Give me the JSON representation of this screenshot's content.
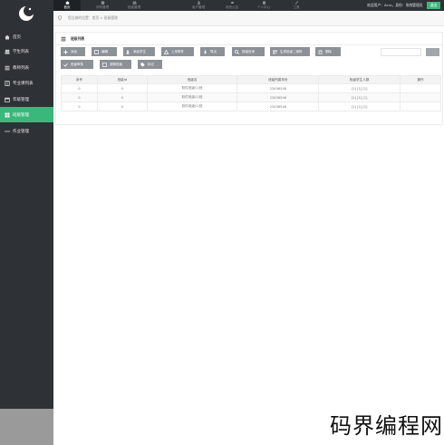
{
  "topbar": {
    "nav": [
      {
        "label": "首页",
        "icon": "home-icon",
        "active": true
      },
      {
        "label": "学院管理",
        "icon": "building-icon",
        "active": false
      },
      {
        "label": "班级管理",
        "icon": "users-icon",
        "active": false
      },
      {
        "label": "用户管理",
        "icon": "user-icon",
        "active": false
      },
      {
        "label": "系统公告",
        "icon": "bell-icon",
        "active": false
      },
      {
        "label": "个人中心",
        "icon": "person-icon",
        "active": false
      },
      {
        "label": "工具",
        "icon": "wrench-icon",
        "active": false
      }
    ],
    "welcome_text": "欢迎用户：Acro，身份：系统管理员",
    "logout_label": "退出"
  },
  "sidebar": {
    "items": [
      {
        "label": "首页",
        "icon": "home-icon",
        "active": false
      },
      {
        "label": "学生列表",
        "icon": "users-icon",
        "active": false
      },
      {
        "label": "教师列表",
        "icon": "list-icon",
        "active": false
      },
      {
        "label": "专业课列表",
        "icon": "book-icon",
        "active": false
      },
      {
        "label": "年级管理",
        "icon": "calendar-icon",
        "active": false
      },
      {
        "label": "班级管理",
        "icon": "grid-icon",
        "active": true
      },
      {
        "label": "作业管理",
        "icon": "more-icon",
        "active": false
      }
    ]
  },
  "breadcrumb": {
    "text": "您当前的位置：首页 > 班级管理"
  },
  "panel": {
    "title": "班级列表",
    "toolbar_row1": [
      {
        "label": "添加",
        "icon": "plus-icon"
      },
      {
        "label": "编辑",
        "icon": "edit-icon"
      },
      {
        "label": "添加学生",
        "icon": "user-plus-icon"
      },
      {
        "label": "上传附件",
        "icon": "upload-icon"
      },
      {
        "label": "导出",
        "icon": "download-icon"
      },
      {
        "label": "班级查询",
        "icon": "search-icon"
      },
      {
        "label": "生成班级二维码",
        "icon": "qrcode-icon"
      },
      {
        "label": "删除",
        "icon": "trash-icon"
      }
    ],
    "toolbar_row2": [
      {
        "label": "班级审核",
        "icon": "check-icon"
      },
      {
        "label": "调换班级",
        "icon": "swap-icon"
      },
      {
        "label": "标记",
        "icon": "tag-icon"
      }
    ],
    "search": {
      "value": "",
      "placeholder": ""
    }
  },
  "table": {
    "columns": [
      "序号",
      "班级id",
      "班级名",
      "班级所属年份",
      "班级学生人数",
      "操作"
    ],
    "rows": [
      [
        "0",
        "0",
        "软件班级(1)班",
        "23456546",
        "[1] [1] [1]",
        ""
      ],
      [
        "0",
        "0",
        "软件班级(1)班",
        "23456546",
        "[1] [1] [1]",
        ""
      ],
      [
        "0",
        "0",
        "软件班级(1)班",
        "23456546",
        "[1] [1] [1]",
        ""
      ]
    ]
  },
  "watermark": "码界编程网",
  "colors": {
    "sidebar_bg": "#2e3236",
    "accent": "#3ab87c",
    "button_bg": "#8c9197"
  }
}
